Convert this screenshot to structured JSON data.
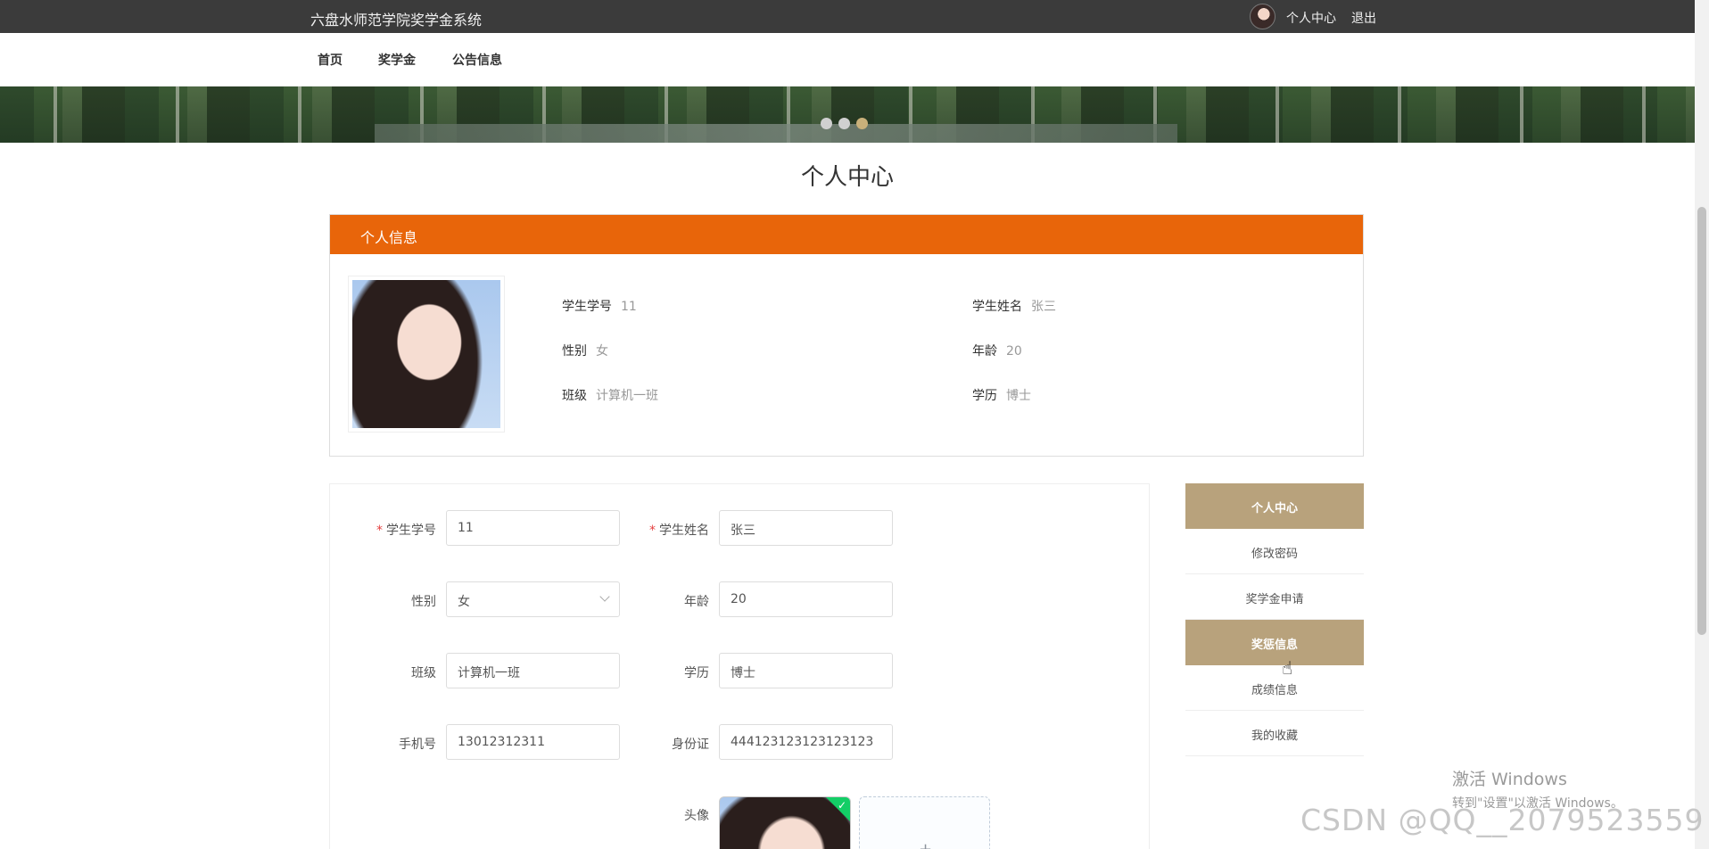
{
  "header": {
    "site_title": "六盘水师范学院奖学金系统",
    "user_center": "个人中心",
    "logout": "退出"
  },
  "nav": {
    "items": [
      "首页",
      "奖学金",
      "公告信息"
    ]
  },
  "banner": {
    "dot_count": 3,
    "active_dot": 3,
    "active_color": "#c9b07a"
  },
  "page_title": "个人中心",
  "info": {
    "header": "个人信息",
    "fields": [
      {
        "label": "学生学号",
        "value": "11"
      },
      {
        "label": "学生姓名",
        "value": "张三"
      },
      {
        "label": "性别",
        "value": "女"
      },
      {
        "label": "年龄",
        "value": "20"
      },
      {
        "label": "班级",
        "value": "计算机一班"
      },
      {
        "label": "学历",
        "value": "博士"
      }
    ]
  },
  "form": {
    "student_no": {
      "label": "学生学号",
      "value": "11",
      "required": true
    },
    "student_name": {
      "label": "学生姓名",
      "value": "张三",
      "required": true
    },
    "gender": {
      "label": "性别",
      "value": "女"
    },
    "age": {
      "label": "年龄",
      "value": "20"
    },
    "class": {
      "label": "班级",
      "value": "计算机一班"
    },
    "education": {
      "label": "学历",
      "value": "博士"
    },
    "phone": {
      "label": "手机号",
      "value": "13012312311"
    },
    "id_card": {
      "label": "身份证",
      "value": "444123123123123123"
    },
    "avatar": {
      "label": "头像",
      "plus": "+"
    }
  },
  "side_menu": {
    "items": [
      {
        "label": "个人中心",
        "active": true
      },
      {
        "label": "修改密码",
        "active": false
      },
      {
        "label": "奖学金申请",
        "active": false
      },
      {
        "label": "奖惩信息",
        "active": true
      },
      {
        "label": "成绩信息",
        "active": false
      },
      {
        "label": "我的收藏",
        "active": false
      }
    ]
  },
  "watermark": {
    "line1": "激活 Windows",
    "line2": "转到\"设置\"以激活 Windows。",
    "csdn": "CSDN @QQ__2079523559"
  },
  "colors": {
    "topbar": "#3b3b3b",
    "accent_orange": "#e8650a",
    "menu_active": "#b8a27c"
  }
}
